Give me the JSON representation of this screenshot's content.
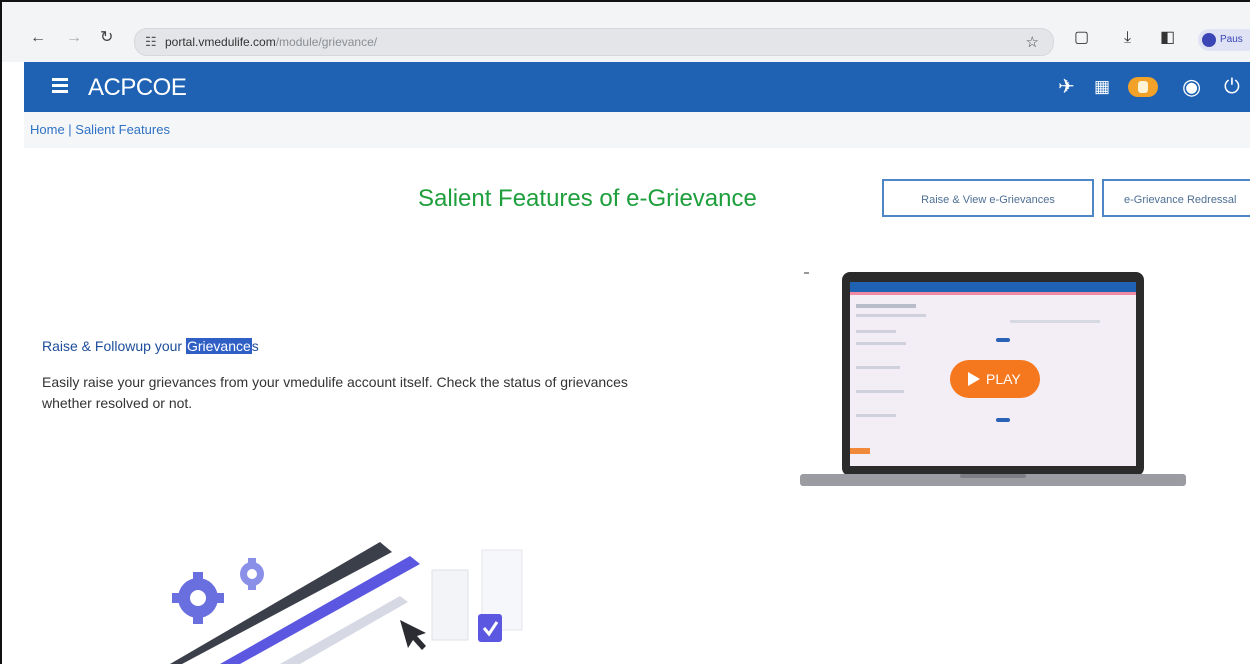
{
  "browser": {
    "url_host": "portal.vmedulife.com",
    "url_path": "/module/grievance/",
    "profile_label": "Paus"
  },
  "header": {
    "brand": "ACPCOE"
  },
  "breadcrumb": {
    "text": "Home | Salient Features"
  },
  "main": {
    "title": "Salient Features of e-Grievance",
    "buttons": [
      "Raise & View e-Grievances",
      "e-Grievance Redressal"
    ],
    "feature": {
      "title_prefix": "Raise & Followup your ",
      "title_highlight": "Grievance",
      "title_suffix": "s",
      "description": "Easily raise your grievances from your vmedulife account itself. Check the status of grievances whether resolved or not."
    },
    "video": {
      "play_label": "PLAY"
    }
  },
  "colors": {
    "header_bg": "#1f62b3",
    "title_green": "#1e9f3c",
    "play_orange": "#f5781f"
  }
}
